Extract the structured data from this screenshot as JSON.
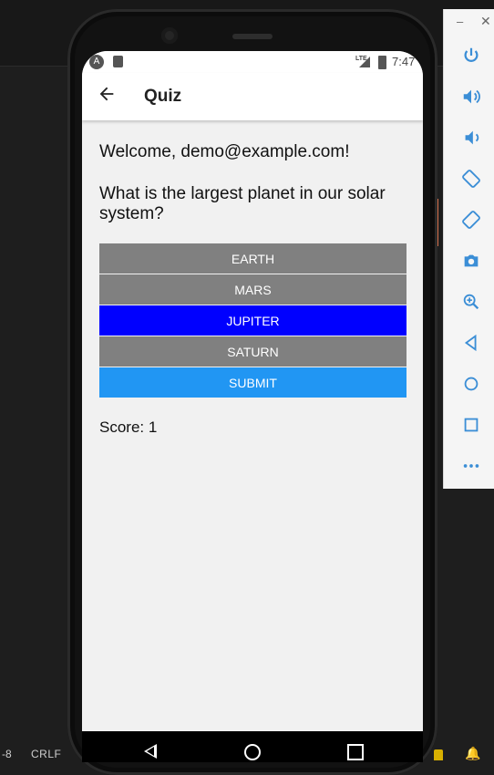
{
  "app": {
    "title": "Quiz"
  },
  "status_bar": {
    "time": "7:47",
    "network": "LTE"
  },
  "quiz": {
    "welcome": "Welcome, demo@example.com!",
    "question": "What is the largest planet in our solar system?",
    "options": [
      "EARTH",
      "MARS",
      "JUPITER",
      "SATURN"
    ],
    "selected_option": "JUPITER",
    "submit_label": "SUBMIT",
    "score_text": "Score: 1"
  },
  "editor_status": {
    "encoding_fragment": "-8",
    "line_endings": "CRLF"
  },
  "colors": {
    "option_default": "#808080",
    "option_selected": "#0000ff",
    "submit": "#2196f3",
    "background": "#f1f1f1"
  },
  "icons": {
    "emulator_toolbar": [
      "power-icon",
      "volume-up-icon",
      "volume-down-icon",
      "rotate-left-icon",
      "rotate-right-icon",
      "camera-icon",
      "zoom-icon",
      "back-icon",
      "home-icon",
      "overview-icon",
      "more-icon"
    ]
  }
}
